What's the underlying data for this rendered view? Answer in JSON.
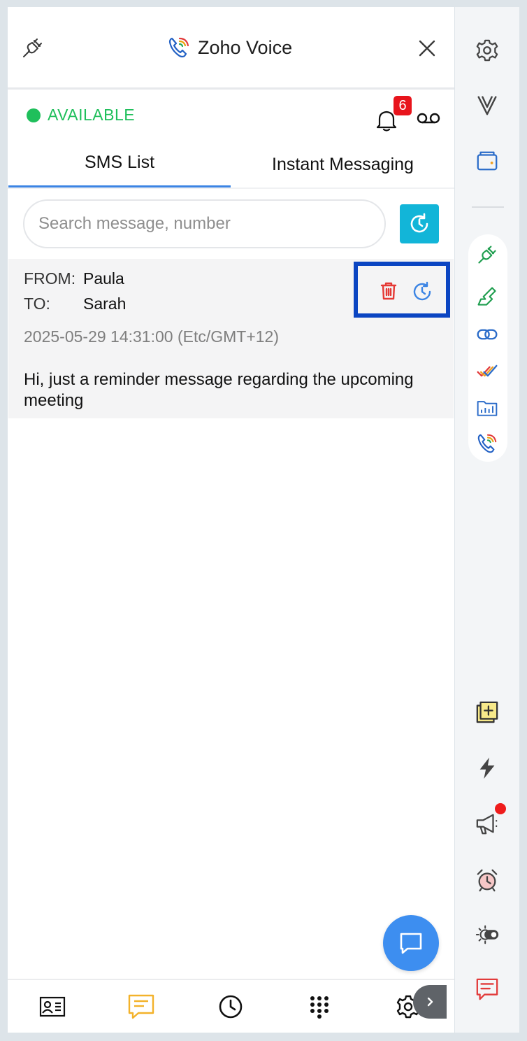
{
  "header": {
    "title": "Zoho Voice"
  },
  "status": {
    "text": "AVAILABLE",
    "color": "#1fbf5b",
    "notification_count": "6"
  },
  "tabs": [
    {
      "label": "SMS List",
      "active": true
    },
    {
      "label": "Instant Messaging",
      "active": false
    }
  ],
  "search": {
    "placeholder": "Search message, number",
    "value": ""
  },
  "message": {
    "from_label": "FROM:",
    "from": "Paula",
    "to_label": "TO:",
    "to": "Sarah",
    "timestamp": "2025-05-29 14:31:00 (Etc/GMT+12)",
    "body": "Hi, just a reminder message regarding the upcoming meeting"
  },
  "bottom_nav": [
    "contacts-icon",
    "messages-icon",
    "history-icon",
    "dialpad-icon",
    "settings-icon"
  ],
  "rail": [
    "settings-icon",
    "vani-icon",
    "wallet-icon",
    "plug-icon",
    "signal-icon",
    "link-icon",
    "checkmarks-icon",
    "chart-folder-icon",
    "voice-icon",
    "add-note-icon",
    "bolt-icon",
    "megaphone-icon",
    "alarm-icon",
    "theme-toggle-icon",
    "feedback-icon"
  ],
  "colors": {
    "accent": "#3b84e4",
    "available": "#1fbf5b",
    "refresh": "#12b5d8",
    "badge": "#e8141c",
    "highlight_box": "#0b45c2"
  }
}
